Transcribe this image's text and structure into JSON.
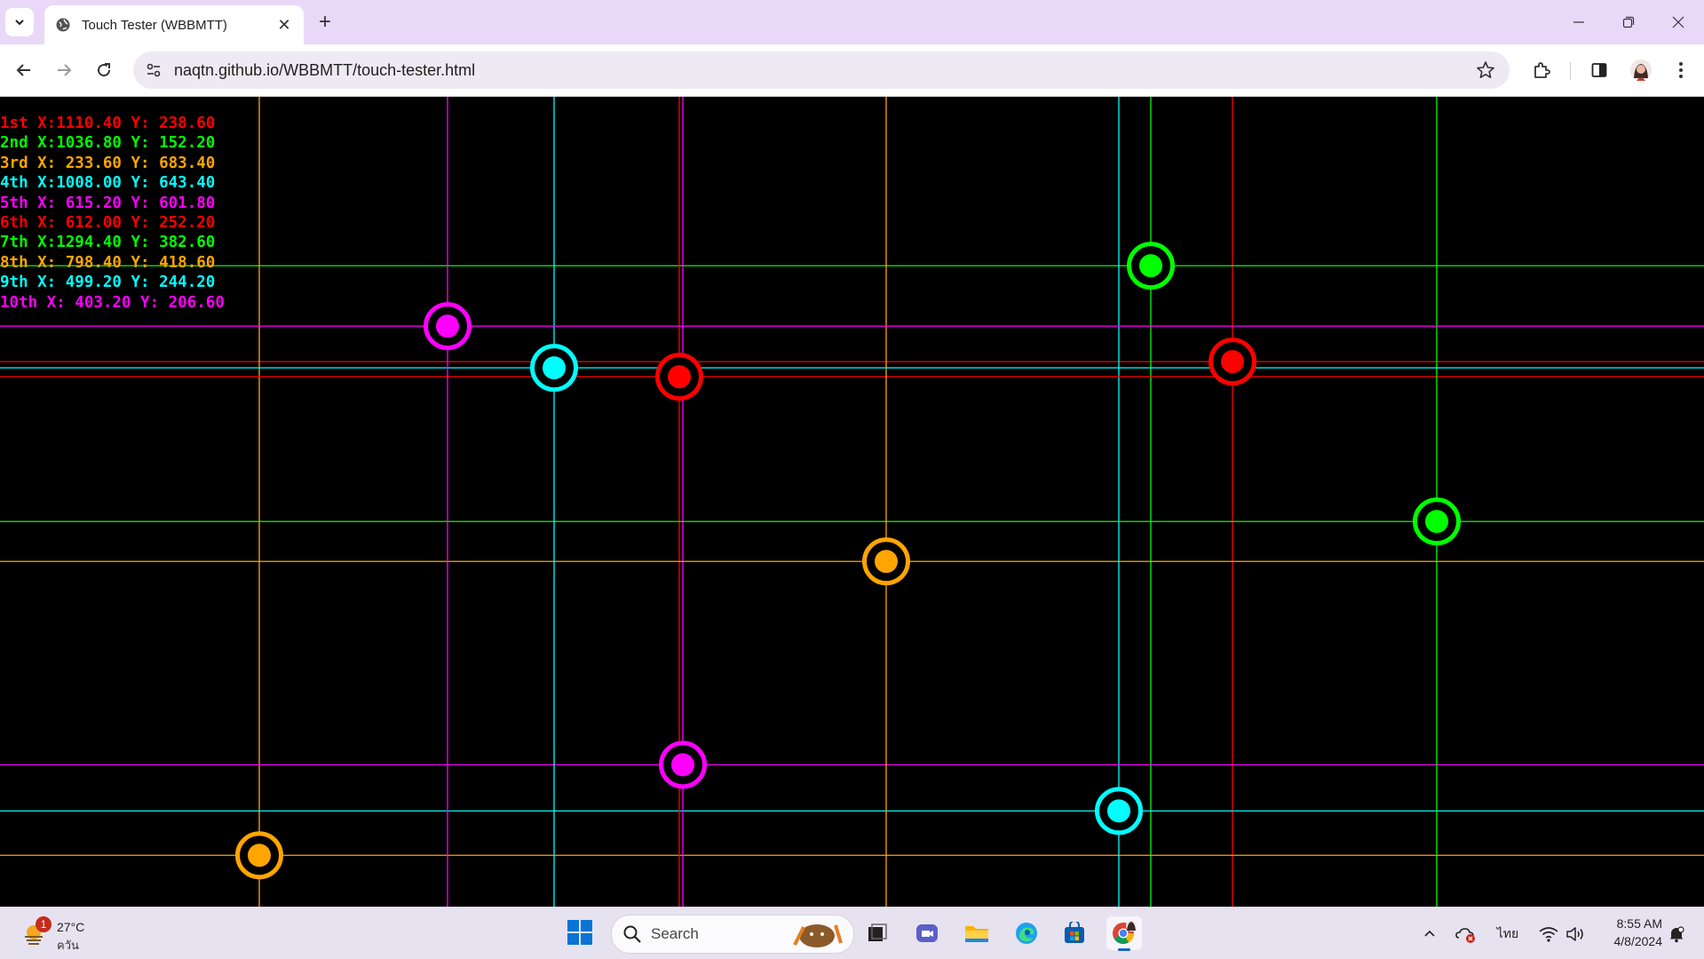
{
  "browser": {
    "tab_title": "Touch Tester (WBBMTT)",
    "url": "naqtn.github.io/WBBMTT/touch-tester.html",
    "icons": [
      "chevron-down-icon",
      "globe-icon",
      "close-icon",
      "plus-icon",
      "minimize-icon",
      "restore-icon",
      "window-close-icon",
      "back-icon",
      "forward-icon",
      "reload-icon",
      "site-info-icon",
      "star-icon",
      "extensions-icon",
      "side-panel-icon",
      "avatar",
      "more-icon"
    ]
  },
  "touches": [
    {
      "label": "1st X:1110.40 Y: 238.60",
      "color": "#ff0000"
    },
    {
      "label": "2nd X:1036.80 Y: 152.20",
      "color": "#00ff00"
    },
    {
      "label": "3rd X: 233.60 Y: 683.40",
      "color": "#ffa500"
    },
    {
      "label": "4th X:1008.00 Y: 643.40",
      "color": "#00ffff"
    },
    {
      "label": "5th X: 615.20 Y: 601.80",
      "color": "#ff00ff"
    },
    {
      "label": "6th X: 612.00 Y: 252.20",
      "color": "#ff0000"
    },
    {
      "label": "7th X:1294.40 Y: 382.60",
      "color": "#00ff00"
    },
    {
      "label": "8th X: 798.40 Y: 418.60",
      "color": "#ffa500"
    },
    {
      "label": "9th X: 499.20 Y: 244.20",
      "color": "#00ffff"
    },
    {
      "label": "10th X: 403.20 Y: 206.60",
      "color": "#ff00ff"
    }
  ],
  "taskbar": {
    "weather_temp": "27°C",
    "weather_desc": "ควัน",
    "weather_badge": "1",
    "search_placeholder": "Search",
    "language": "ไทย",
    "time": "8:55 AM",
    "date": "4/8/2024"
  }
}
